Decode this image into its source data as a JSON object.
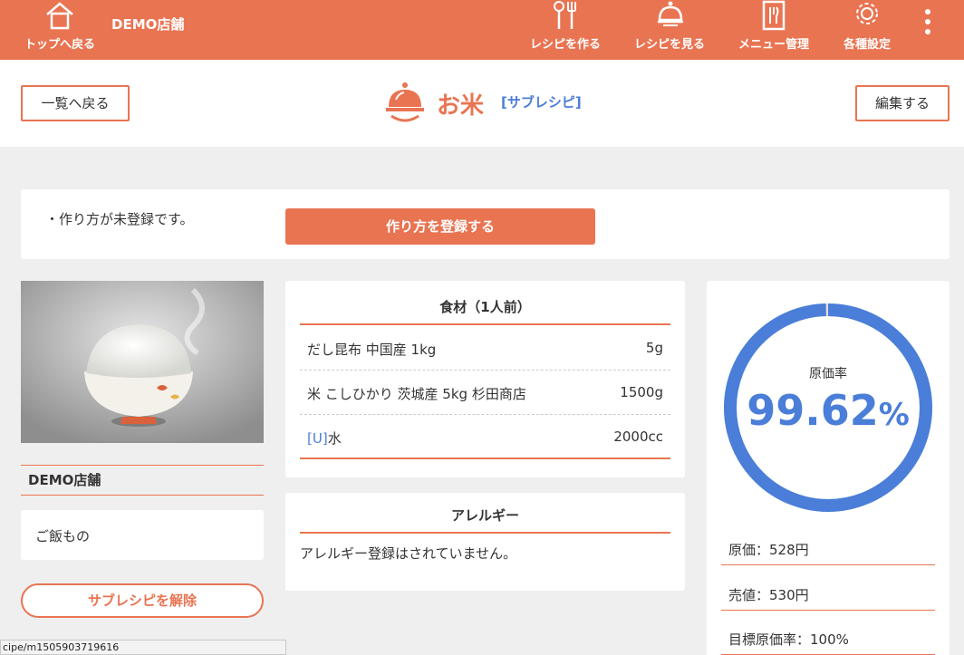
{
  "colors": {
    "brand": "#e97452",
    "accent_blue": "#4a7ed8",
    "background": "#efefef"
  },
  "nav": {
    "home_label": "トップへ戻る",
    "store_name": "DEMO店舗",
    "items": [
      {
        "label": "レシピを作る",
        "icon": "utensils-icon"
      },
      {
        "label": "レシピを見る",
        "icon": "cloche-icon"
      },
      {
        "label": "メニュー管理",
        "icon": "menu-book-icon"
      },
      {
        "label": "各種設定",
        "icon": "gear-icon"
      }
    ],
    "more_icon": "kebab-menu-icon"
  },
  "header": {
    "back_label": "一覧へ戻る",
    "title": "お米",
    "sub_tag": "[サブレシピ]",
    "edit_label": "編集する"
  },
  "method": {
    "note": "・作り方が未登録です。",
    "register_label": "作り方を登録する"
  },
  "left": {
    "store_label": "DEMO店舗",
    "category": "ご飯もの",
    "unlink_label": "サブレシピを解除"
  },
  "ingredients": {
    "heading": "食材（1人前）",
    "rows": [
      {
        "tag": "",
        "name": "だし昆布 中国産 1kg",
        "qty": "5g"
      },
      {
        "tag": "",
        "name": "米 こしひかり 茨城産 5kg 杉田商店",
        "qty": "1500g"
      },
      {
        "tag": "[U]",
        "name": "水",
        "qty": "2000cc"
      }
    ]
  },
  "allergy": {
    "heading": "アレルギー",
    "text": "アレルギー登録はされていません。"
  },
  "cost": {
    "ratio_label": "原価率",
    "ratio_value": "99.62",
    "ratio_unit": "%",
    "ratio_fraction": 0.9962,
    "cost_line": "原価：528円",
    "price_line": "売値：530円",
    "target_line": "目標原価率：100%"
  },
  "status_url": "cipe/m1505903719616"
}
